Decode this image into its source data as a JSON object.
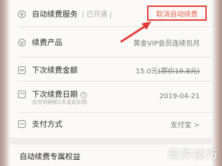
{
  "service": {
    "label": "自动续费服务",
    "status": "| 已开通 |",
    "cancel_button": "取消自动续费"
  },
  "rows": {
    "product_label": "续费产品",
    "product_value": "黄金VIP会员连续包月",
    "amount_label": "下次续费金额",
    "amount_value": "15.0元",
    "amount_original": "(原价19.8元)",
    "date_label": "下次续费日期",
    "date_help": "?",
    "date_value": "2019-04-21",
    "date_note": "会员到期前1天发起扣款",
    "payment_label": "支付方式",
    "payment_value": "支付宝",
    "payment_chevron": ">"
  },
  "benefits": {
    "title": "自动续费专属权益"
  },
  "watermark": "软件技巧",
  "colors": {
    "highlight": "#e83a35",
    "cancel_text": "#e0664f"
  }
}
